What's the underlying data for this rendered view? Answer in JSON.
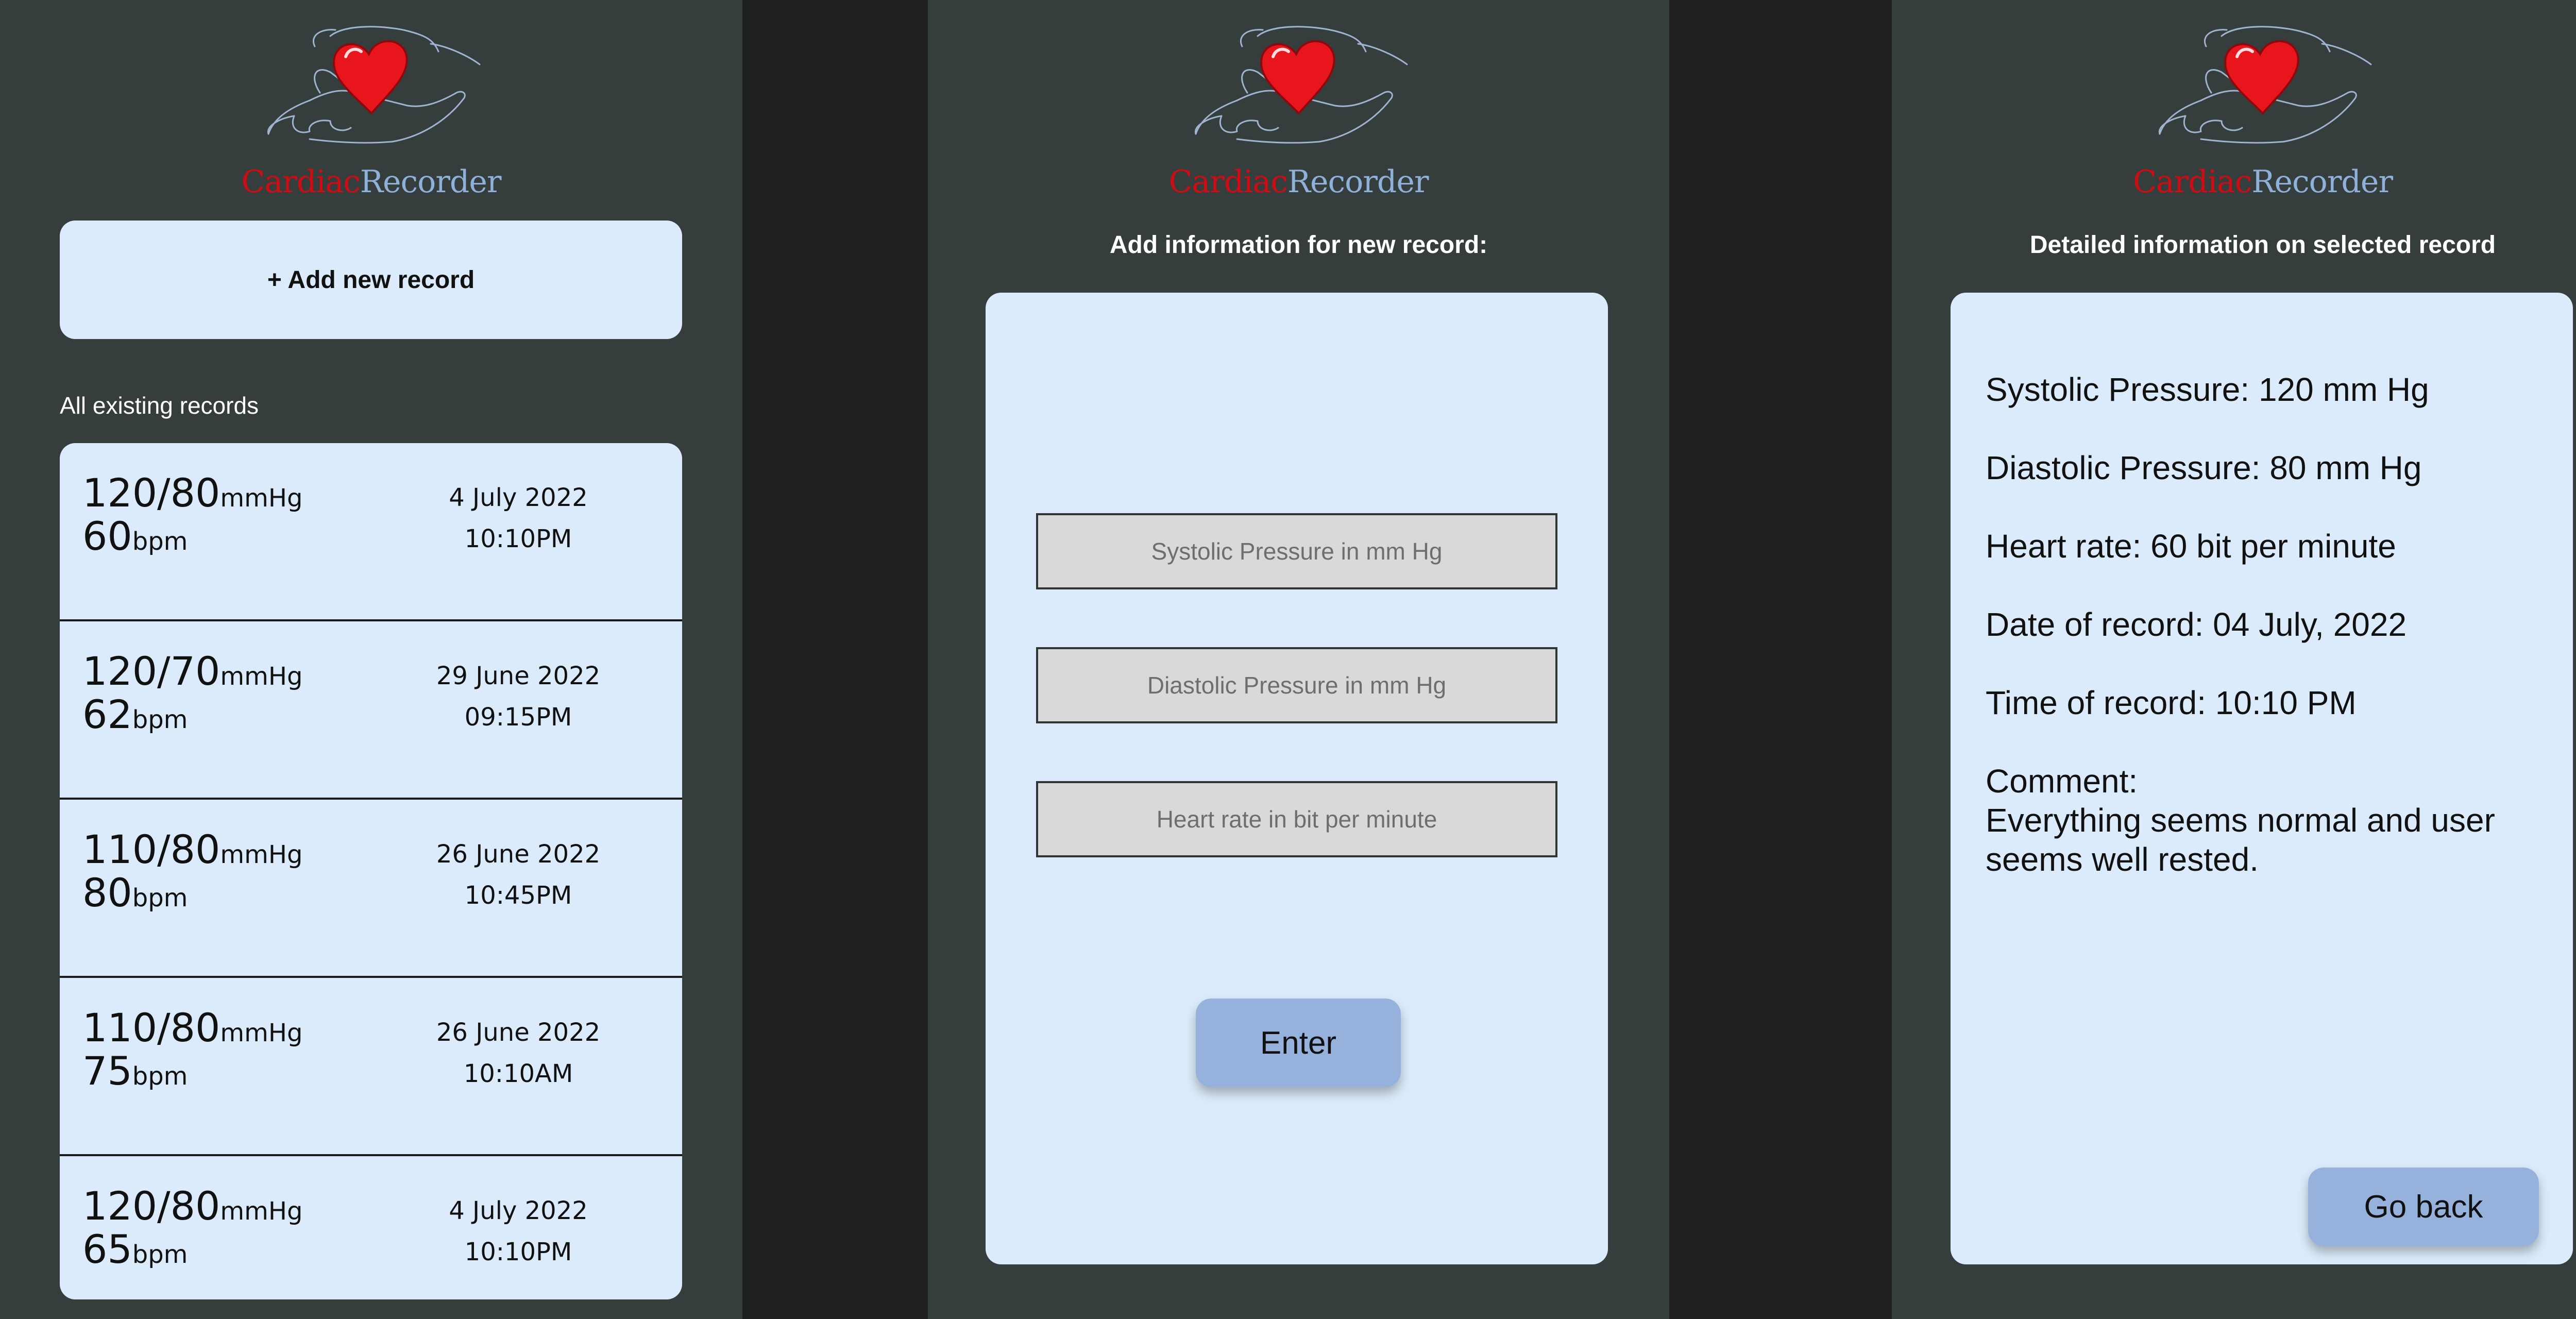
{
  "app": {
    "logo_part1": "Cardiac",
    "logo_part2": "Recorder",
    "logo_image": "hand-holding-heart-icon",
    "colors": {
      "background": "#353e3d",
      "card": "#dcebfb",
      "button": "#96b2dc",
      "logo_red": "#d10b12",
      "logo_blue": "#8fb0d8"
    }
  },
  "list_screen": {
    "add_button_label": "+ Add new record",
    "section_label": "All existing records",
    "records": [
      {
        "bp": "120/80",
        "bp_unit": "mmHg",
        "hr": "60",
        "hr_unit": "bpm",
        "date": "4 July 2022",
        "time": "10:10PM"
      },
      {
        "bp": "120/70",
        "bp_unit": "mmHg",
        "hr": "62",
        "hr_unit": "bpm",
        "date": "29 June 2022",
        "time": "09:15PM"
      },
      {
        "bp": "110/80",
        "bp_unit": "mmHg",
        "hr": "80",
        "hr_unit": "bpm",
        "date": "26 June 2022",
        "time": "10:45PM"
      },
      {
        "bp": "110/80",
        "bp_unit": "mmHg",
        "hr": "75",
        "hr_unit": "bpm",
        "date": "26 June 2022",
        "time": "10:10AM"
      },
      {
        "bp": "120/80",
        "bp_unit": "mmHg",
        "hr": "65",
        "hr_unit": "bpm",
        "date": "4 July 2022",
        "time": "10:10PM"
      }
    ]
  },
  "add_screen": {
    "heading": "Add information for new record:",
    "systolic_placeholder": "Systolic Pressure in mm Hg",
    "diastolic_placeholder": "Diastolic Pressure in mm Hg",
    "heart_rate_placeholder": "Heart rate in bit per minute",
    "enter_label": "Enter"
  },
  "detail_screen": {
    "heading": "Detailed information on selected record",
    "systolic": "Systolic Pressure: 120 mm Hg",
    "diastolic": "Diastolic Pressure: 80 mm Hg",
    "heart_rate": "Heart rate: 60 bit per minute",
    "date": "Date of record: 04 July, 2022",
    "time": "Time of record: 10:10 PM",
    "comment_label": "Comment:",
    "comment_text": "Everything seems normal and user seems well rested.",
    "back_label": "Go back"
  }
}
